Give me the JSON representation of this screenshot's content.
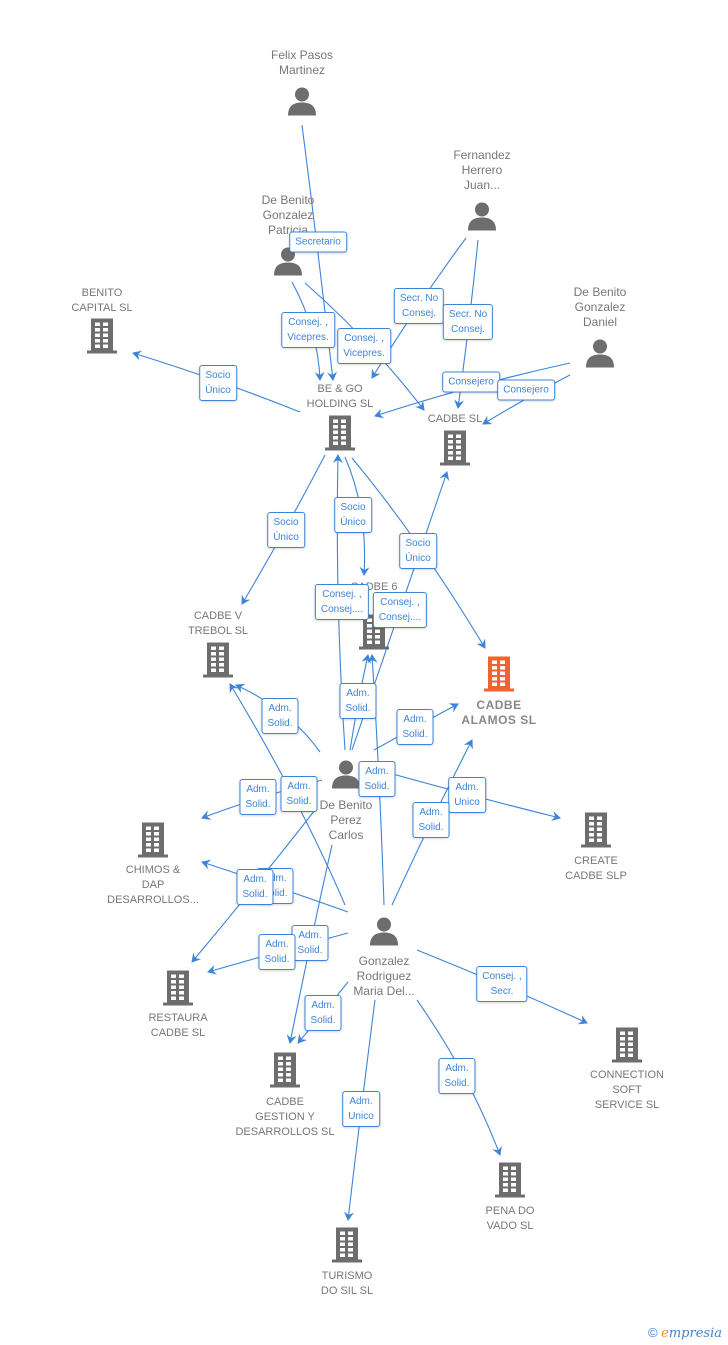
{
  "colors": {
    "edge": "#3d84d8",
    "node": "#6d6d6d",
    "highlight": "#f4622d"
  },
  "nodes": {
    "felix": {
      "label": "Felix Pasos\nMartinez",
      "type": "person"
    },
    "fernandez": {
      "label": "Fernandez\nHerrero\nJuan...",
      "type": "person"
    },
    "patricia": {
      "label": "De Benito\nGonzalez\nPatricia",
      "type": "person"
    },
    "daniel": {
      "label": "De Benito\nGonzalez\nDaniel",
      "type": "person"
    },
    "carlos": {
      "label": "De Benito\nPerez\nCarlos",
      "type": "person"
    },
    "gonzalez": {
      "label": "Gonzalez\nRodriguez\nMaria Del...",
      "type": "person"
    },
    "benito_capital": {
      "label": "BENITO\nCAPITAL SL",
      "type": "company"
    },
    "be_go": {
      "label": "BE & GO\nHOLDING SL",
      "type": "company"
    },
    "cadbe_sl": {
      "label": "CADBE SL",
      "type": "company"
    },
    "cadbe6": {
      "label": "CADBE 6",
      "type": "company"
    },
    "cadbe_v": {
      "label": "CADBE V\nTREBOL  SL",
      "type": "company"
    },
    "cadbe_alamos": {
      "label": "CADBE\nALAMOS  SL",
      "type": "company",
      "highlighted": true
    },
    "create": {
      "label": "CREATE\nCADBE  SLP",
      "type": "company"
    },
    "chimos": {
      "label": "CHIMOS &\nDAP\nDESARROLLOS...",
      "type": "company"
    },
    "restaura": {
      "label": "RESTAURA\nCADBE SL",
      "type": "company"
    },
    "connection": {
      "label": "CONNECTION\nSOFT\nSERVICE SL",
      "type": "company"
    },
    "gestion": {
      "label": "CADBE\nGESTION Y\nDESARROLLOS SL",
      "type": "company"
    },
    "pena": {
      "label": "PENA DO\nVADO SL",
      "type": "company"
    },
    "turismo": {
      "label": "TURISMO\nDO SIL  SL",
      "type": "company"
    }
  },
  "edges": [
    {
      "from": "felix",
      "to": "be_go",
      "label": "Secretario"
    },
    {
      "from": "patricia",
      "to": "be_go",
      "label": "Consej. ,\nVicepres."
    },
    {
      "from": "patricia",
      "to": "cadbe_sl",
      "label": "Consej. ,\nVicepres."
    },
    {
      "from": "fernandez",
      "to": "be_go",
      "label": "Secr.  No\nConsej."
    },
    {
      "from": "fernandez",
      "to": "cadbe_sl",
      "label": "Secr.  No\nConsej."
    },
    {
      "from": "be_go",
      "to": "benito_capital",
      "label": "Socio\nÚnico"
    },
    {
      "from": "daniel",
      "to": "be_go",
      "label": "Consejero"
    },
    {
      "from": "daniel",
      "to": "cadbe_sl",
      "label": "Consejero"
    },
    {
      "from": "be_go",
      "to": "cadbe_v",
      "label": "Socio\nÚnico"
    },
    {
      "from": "be_go",
      "to": "cadbe6",
      "label": "Socio\nÚnico"
    },
    {
      "from": "be_go",
      "to": "cadbe_alamos",
      "label": "Socio\nÚnico"
    },
    {
      "from": "carlos",
      "to": "be_go",
      "label": "Consej. ,\nConsej...."
    },
    {
      "from": "carlos",
      "to": "cadbe_sl",
      "label": "Consej. ,\nConsej...."
    },
    {
      "from": "carlos",
      "to": "cadbe_v",
      "label": "Adm.\nSolid."
    },
    {
      "from": "carlos",
      "to": "cadbe6",
      "label": "Adm.\nSolid."
    },
    {
      "from": "carlos",
      "to": "cadbe_alamos",
      "label": "Adm.\nSolid."
    },
    {
      "from": "gonzalez",
      "to": "cadbe6",
      "label": "Adm.\nSolid."
    },
    {
      "from": "carlos",
      "to": "chimos",
      "label": "Adm.\nSolid."
    },
    {
      "from": "gonzalez",
      "to": "cadbe_v",
      "label": "Adm.\nSolid."
    },
    {
      "from": "carlos",
      "to": "create",
      "label": "Adm.\nUnico"
    },
    {
      "from": "gonzalez",
      "to": "cadbe_alamos",
      "label": "Adm.\nSolid."
    },
    {
      "from": "gonzalez",
      "to": "chimos",
      "label": "Adm.\nSolid."
    },
    {
      "from": "carlos",
      "to": "restaura",
      "label": "Adm.\nSolid."
    },
    {
      "from": "carlos",
      "to": "gestion",
      "label": "Adm.\nSolid."
    },
    {
      "from": "gonzalez",
      "to": "restaura",
      "label": "Adm.\nSolid."
    },
    {
      "from": "gonzalez",
      "to": "gestion",
      "label": "Adm.\nSolid."
    },
    {
      "from": "gonzalez",
      "to": "connection",
      "label": "Consej. ,\nSecr."
    },
    {
      "from": "gonzalez",
      "to": "pena",
      "label": "Adm.\nSolid."
    },
    {
      "from": "gonzalez",
      "to": "turismo",
      "label": "Adm.\nUnico"
    }
  ],
  "footer": {
    "copyright": "©",
    "brand_first": "e",
    "brand_rest": "mpresia"
  }
}
